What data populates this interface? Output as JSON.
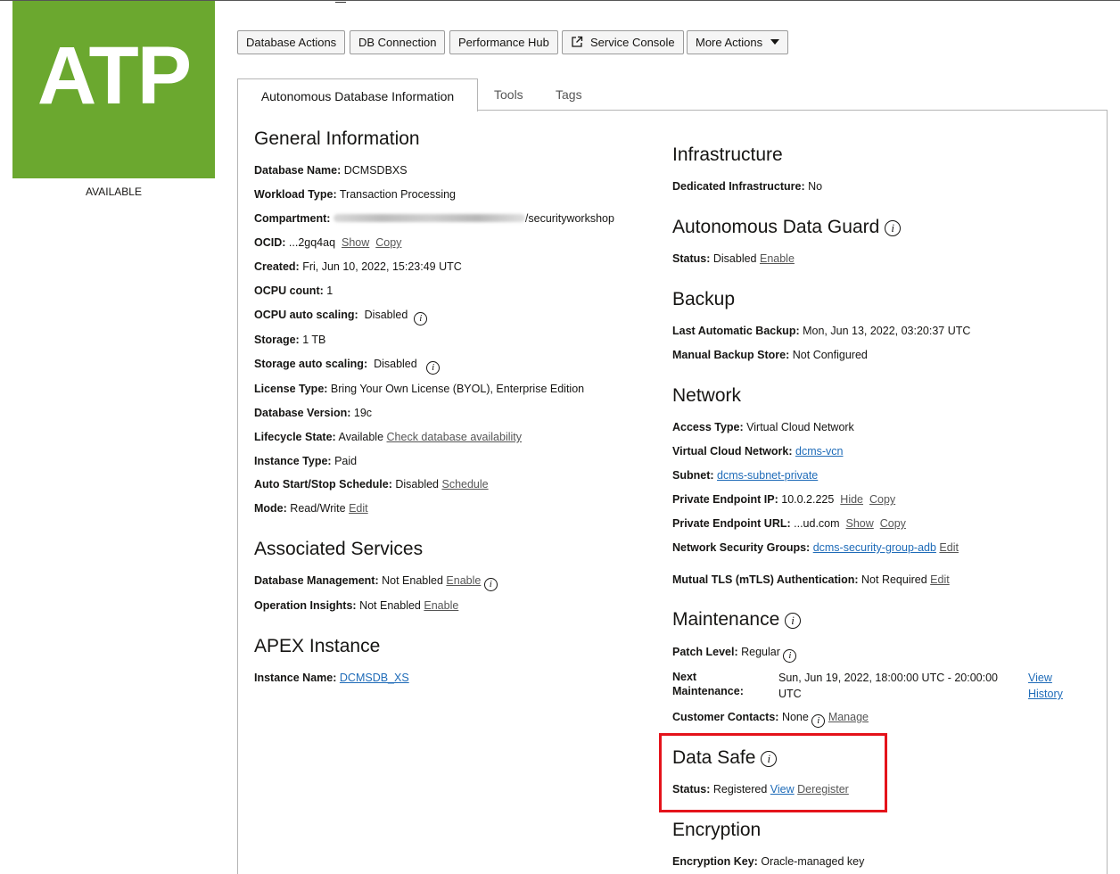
{
  "badge": {
    "text": "ATP",
    "color": "#6ba82f",
    "state": "AVAILABLE"
  },
  "actions": {
    "database_actions": "Database Actions",
    "db_connection": "DB Connection",
    "performance_hub": "Performance Hub",
    "service_console": "Service Console",
    "more_actions": "More Actions"
  },
  "tabs": {
    "info": "Autonomous Database Information",
    "tools": "Tools",
    "tags": "Tags"
  },
  "links": {
    "show": "Show",
    "copy": "Copy",
    "hide": "Hide",
    "edit": "Edit",
    "enable": "Enable",
    "manage": "Manage",
    "view": "View",
    "deregister": "Deregister"
  },
  "general": {
    "title": "General Information",
    "db_name_label": "Database Name:",
    "db_name": "DCMSDBXS",
    "workload_label": "Workload Type:",
    "workload": "Transaction Processing",
    "compartment_label": "Compartment:",
    "compartment_tail": "/securityworkshop",
    "ocid_label": "OCID:",
    "ocid": "...2gq4aq",
    "created_label": "Created:",
    "created": "Fri, Jun 10, 2022, 15:23:49 UTC",
    "ocpu_label": "OCPU count:",
    "ocpu": "1",
    "ocpu_auto_label": "OCPU auto scaling:",
    "ocpu_auto": "Disabled",
    "storage_label": "Storage:",
    "storage": "1 TB",
    "storage_auto_label": "Storage auto scaling:",
    "storage_auto": "Disabled",
    "license_label": "License Type:",
    "license": "Bring Your Own License (BYOL), Enterprise Edition",
    "version_label": "Database Version:",
    "version": "19c",
    "lifecycle_label": "Lifecycle State:",
    "lifecycle": "Available",
    "lifecycle_link": "Check database availability",
    "instance_type_label": "Instance Type:",
    "instance_type": "Paid",
    "schedule_label": "Auto Start/Stop Schedule:",
    "schedule": "Disabled",
    "schedule_link": "Schedule",
    "mode_label": "Mode:",
    "mode": "Read/Write"
  },
  "associated": {
    "title": "Associated Services",
    "dbm_label": "Database Management:",
    "dbm": "Not Enabled",
    "opi_label": "Operation Insights:",
    "opi": "Not Enabled"
  },
  "apex": {
    "title": "APEX Instance",
    "name_label": "Instance Name:",
    "name": "DCMSDB_XS"
  },
  "infra": {
    "title": "Infrastructure",
    "dedicated_label": "Dedicated Infrastructure:",
    "dedicated": "No"
  },
  "dataguard": {
    "title": "Autonomous Data Guard",
    "status_label": "Status:",
    "status": "Disabled"
  },
  "backup": {
    "title": "Backup",
    "last_label": "Last Automatic Backup:",
    "last": "Mon, Jun 13, 2022, 03:20:37 UTC",
    "manual_label": "Manual Backup Store:",
    "manual": "Not Configured"
  },
  "network": {
    "title": "Network",
    "access_label": "Access Type:",
    "access": "Virtual Cloud Network",
    "vcn_label": "Virtual Cloud Network:",
    "vcn": "dcms-vcn",
    "subnet_label": "Subnet:",
    "subnet": "dcms-subnet-private",
    "pe_ip_label": "Private Endpoint IP:",
    "pe_ip": "10.0.2.225",
    "pe_url_label": "Private Endpoint URL:",
    "pe_url": "...ud.com",
    "nsg_label": "Network Security Groups:",
    "nsg": "dcms-security-group-adb",
    "mtls_label": "Mutual TLS (mTLS) Authentication:",
    "mtls": "Not Required"
  },
  "maintenance": {
    "title": "Maintenance",
    "patch_label": "Patch Level:",
    "patch": "Regular",
    "next_label_1": "Next",
    "next_label_2": "Maintenance:",
    "next_1": "Sun, Jun 19, 2022, 18:00:00 UTC - 20:00:00",
    "next_2": "UTC",
    "history_1": "View",
    "history_2": "History",
    "contacts_label": "Customer Contacts:",
    "contacts": "None"
  },
  "datasafe": {
    "title": "Data Safe",
    "status_label": "Status:",
    "status": "Registered"
  },
  "encryption": {
    "title": "Encryption",
    "key_label": "Encryption Key:",
    "key": "Oracle-managed key"
  }
}
